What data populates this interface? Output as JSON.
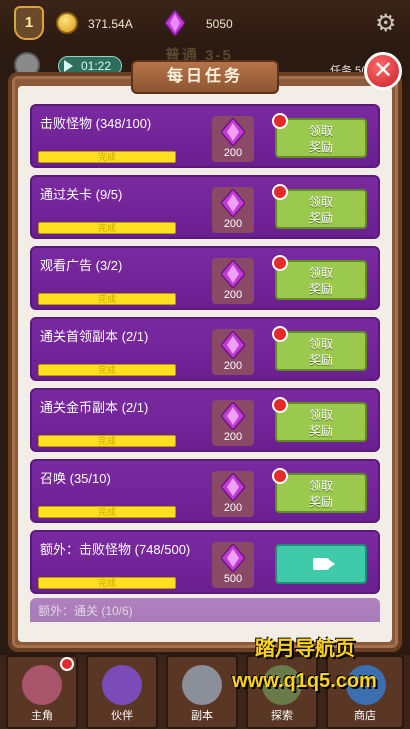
{
  "hud": {
    "level": "1",
    "coins": "371.54A",
    "gems": "5050",
    "stage": "普通 3-5",
    "timer": "01:22",
    "task_label": "任务 5("
  },
  "panel": {
    "title": "每日任务",
    "close_label": "✕"
  },
  "quests": [
    {
      "title": "击败怪物 (348/100)",
      "progress": "完成",
      "reward": "200",
      "claim": "领取\n奖励",
      "claimable": true
    },
    {
      "title": "通过关卡 (9/5)",
      "progress": "完成",
      "reward": "200",
      "claim": "领取\n奖励",
      "claimable": true
    },
    {
      "title": "观看广告 (3/2)",
      "progress": "完成",
      "reward": "200",
      "claim": "领取\n奖励",
      "claimable": true
    },
    {
      "title": "通关首领副本 (2/1)",
      "progress": "完成",
      "reward": "200",
      "claim": "领取\n奖励",
      "claimable": true
    },
    {
      "title": "通关金币副本 (2/1)",
      "progress": "完成",
      "reward": "200",
      "claim": "领取\n奖励",
      "claimable": true
    },
    {
      "title": "召唤 (35/10)",
      "progress": "完成",
      "reward": "200",
      "claim": "领取\n奖励",
      "claimable": true
    },
    {
      "title": "额外：击败怪物 (748/500)",
      "progress": "完成",
      "reward": "500",
      "claim": "",
      "claimable": false
    }
  ],
  "peek_title": "额外：通关 (10/6)",
  "nav": [
    {
      "label": "主角"
    },
    {
      "label": "伙伴"
    },
    {
      "label": "副本"
    },
    {
      "label": "探索"
    },
    {
      "label": "商店"
    }
  ],
  "watermark": {
    "line1": "踏月导航页",
    "line2": "www.q1q5.com"
  },
  "colors": {
    "quest_bg": "#7a2aa0",
    "claim_green": "#9ac94e",
    "video_teal": "#3fcaa9",
    "progress_yellow": "#ffe020",
    "gem_purple": "#c43ad8"
  }
}
